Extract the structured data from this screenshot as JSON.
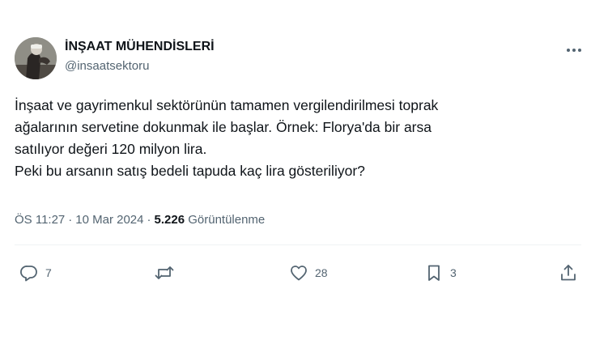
{
  "author": {
    "name": "İNŞAAT MÜHENDİSLERİ",
    "handle": "@insaatsektoru"
  },
  "tweet": {
    "lines": [
      "İnşaat ve gayrimenkul sektörünün tamamen vergilendirilmesi toprak",
      "ağalarının servetine dokunmak ile başlar. Örnek: Florya'da bir arsa",
      "satılıyor değeri 120 milyon lira.",
      "Peki bu arsanın satış bedeli tapuda kaç lira gösteriliyor?"
    ]
  },
  "meta": {
    "time": "ÖS 11:27",
    "separator": "·",
    "date": "10 Mar 2024",
    "views_count": "5.226",
    "views_label": "Görüntülenme"
  },
  "actions": {
    "replies": "7",
    "retweets": "",
    "likes": "28",
    "bookmarks": "3"
  },
  "icons": [
    "reply-icon",
    "retweet-icon",
    "like-icon",
    "bookmark-icon",
    "share-icon",
    "more-icon"
  ],
  "colors": {
    "text": "#0f1419",
    "secondary": "#536471",
    "divider": "#eff3f4"
  }
}
